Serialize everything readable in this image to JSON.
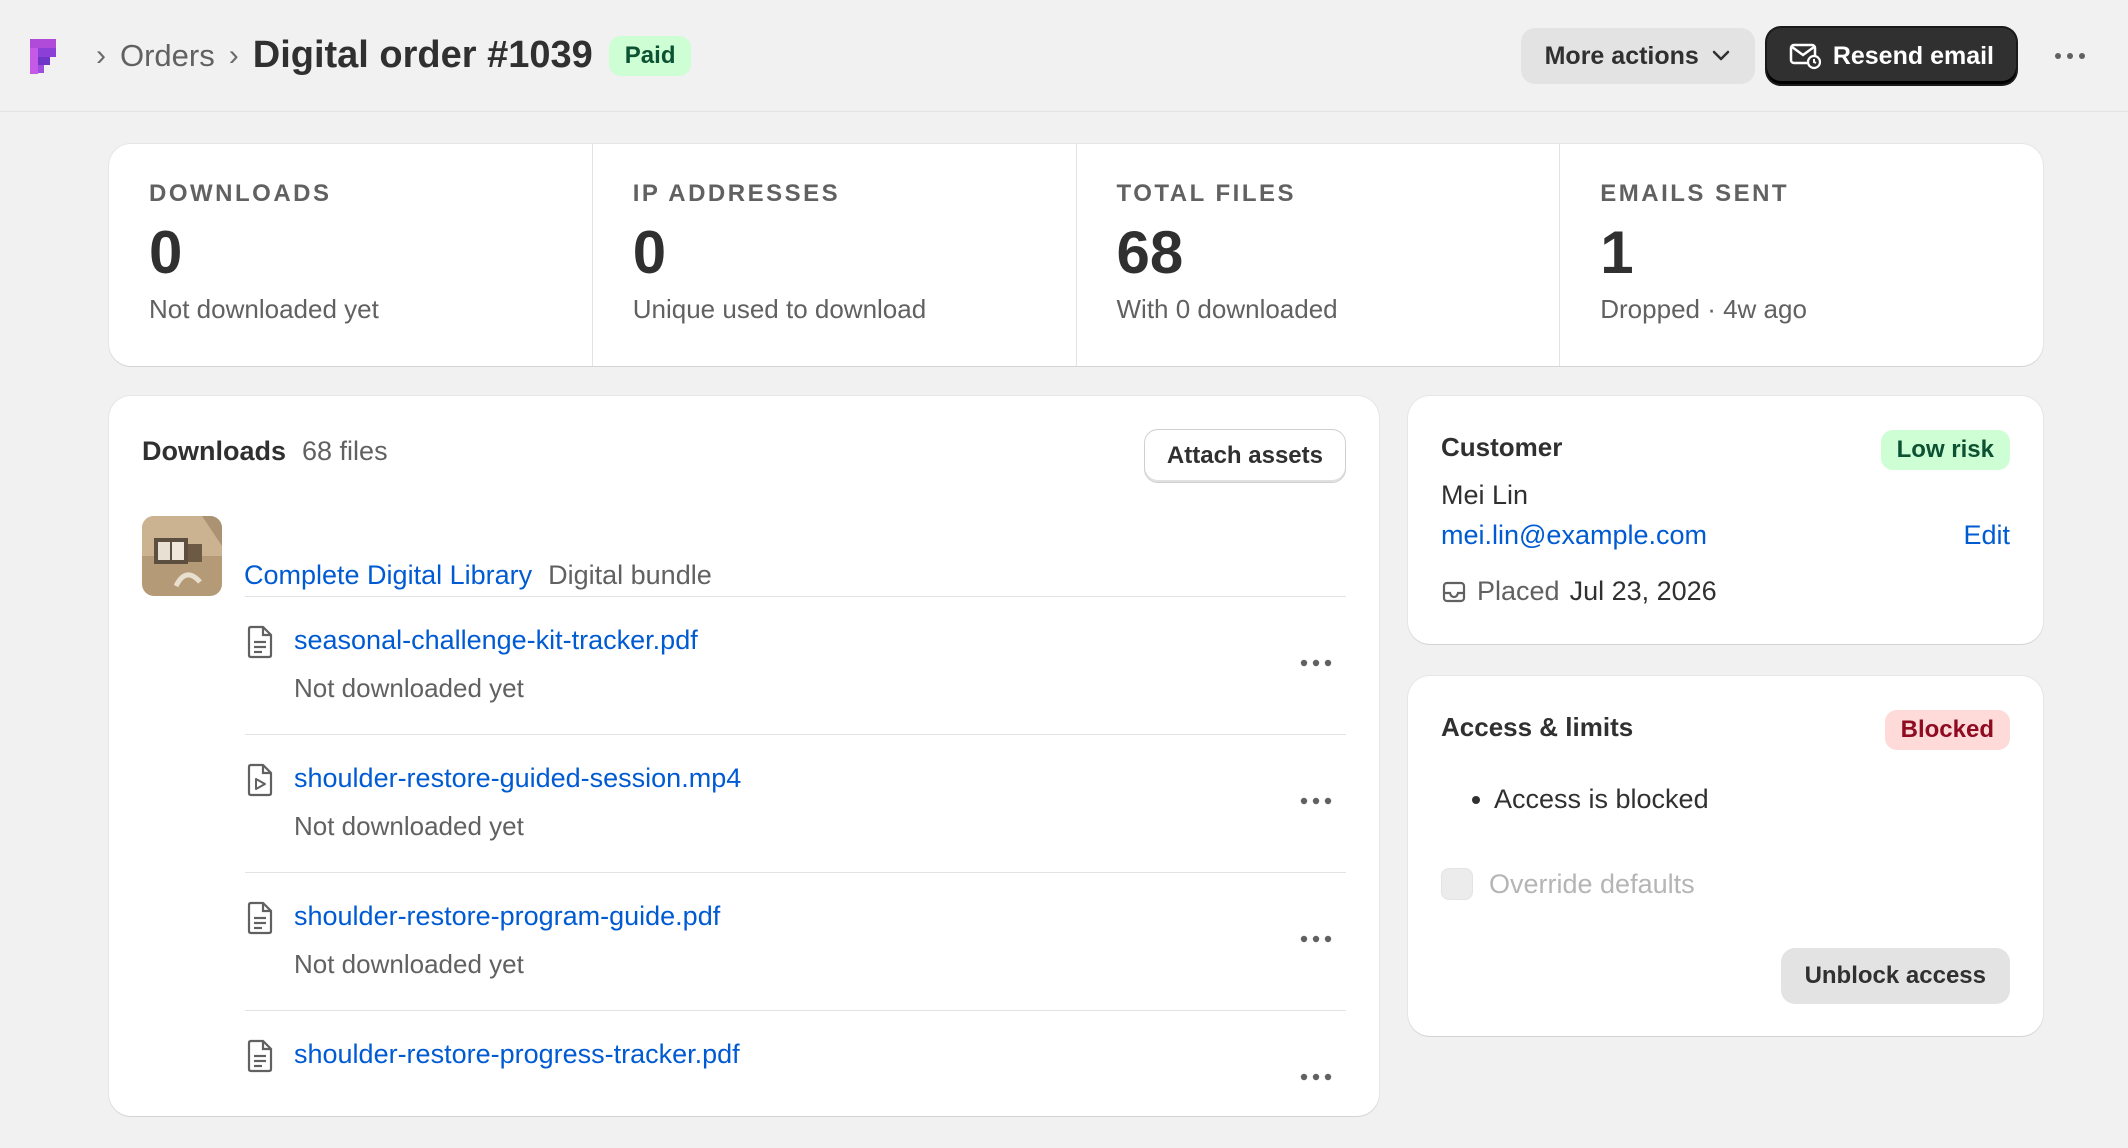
{
  "header": {
    "breadcrumb_parent": "Orders",
    "title": "Digital order #1039",
    "status_badge": "Paid",
    "more_actions_label": "More actions",
    "resend_label": "Resend email"
  },
  "stats": [
    {
      "label": "DOWNLOADS",
      "value": "0",
      "sub": "Not downloaded yet"
    },
    {
      "label": "IP ADDRESSES",
      "value": "0",
      "sub": "Unique used to download"
    },
    {
      "label": "TOTAL FILES",
      "value": "68",
      "sub": "With 0 downloaded"
    },
    {
      "label": "EMAILS SENT",
      "value": "1",
      "sub": "Dropped · 4w ago"
    }
  ],
  "downloads": {
    "title": "Downloads",
    "count": "68 files",
    "attach_label": "Attach assets",
    "product_name": "Complete Digital Library",
    "product_type": "Digital bundle",
    "files": [
      {
        "name": "seasonal-challenge-kit-tracker.pdf",
        "status": "Not downloaded yet",
        "icon": "document-icon"
      },
      {
        "name": "shoulder-restore-guided-session.mp4",
        "status": "Not downloaded yet",
        "icon": "video-file-icon"
      },
      {
        "name": "shoulder-restore-program-guide.pdf",
        "status": "Not downloaded yet",
        "icon": "document-icon"
      },
      {
        "name": "shoulder-restore-progress-tracker.pdf",
        "status": "",
        "icon": "document-icon"
      }
    ]
  },
  "customer": {
    "title": "Customer",
    "risk_badge": "Low risk",
    "name": "Mei Lin",
    "email": "mei.lin@example.com",
    "edit_label": "Edit",
    "placed_label": "Placed",
    "placed_date": "Jul 23, 2026"
  },
  "access": {
    "title": "Access & limits",
    "status_badge": "Blocked",
    "bullet": "Access is blocked",
    "override_label": "Override defaults",
    "unblock_label": "Unblock access"
  },
  "colors": {
    "link": "#005bd3",
    "success_bg": "#cdfed4",
    "critical_bg": "#fedad9",
    "primary_button": "#303030"
  }
}
